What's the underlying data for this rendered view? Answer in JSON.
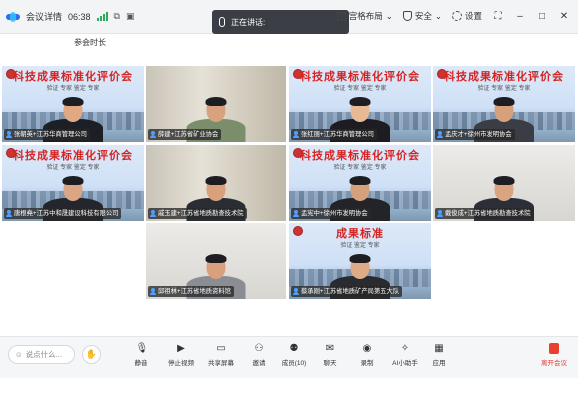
{
  "titlebar": {
    "app_title": "会议详情",
    "time": "06:38",
    "speaking_label": "正在讲话:",
    "layout_label": "宫格布局",
    "security_label": "安全",
    "settings_label": "设置",
    "window_controls": [
      "fullscreen-icon",
      "minimize-icon",
      "maximize-icon",
      "close-icon"
    ]
  },
  "join_time_label": "参会时长",
  "banner": {
    "title": "科技成果标准化评价会",
    "subtitle": "验证 专家 鉴定 专家"
  },
  "banner_short": {
    "title": "成果标准",
    "subtitle": "验证 鉴定 专家"
  },
  "participants": [
    {
      "name": "张朝英+江苏华商管理公司",
      "bg": "banner"
    },
    {
      "name": "薛建+江苏省矿业协会",
      "bg": "room"
    },
    {
      "name": "张红丽+江苏华商管理公司",
      "bg": "banner"
    },
    {
      "name": "孟庆才+徐州市发明协会",
      "bg": "banner",
      "active": true
    },
    {
      "name": "唐根堯+江苏中和晟建设科技有限公司",
      "bg": "banner"
    },
    {
      "name": "戚玉建+江苏省地质勘查技术院",
      "bg": "room"
    },
    {
      "name": "孟宪中+徐州市发明协会",
      "bg": "banner"
    },
    {
      "name": "戴俊成+江苏省地质勘查技术院",
      "bg": "wall"
    },
    {
      "name": "邱祖林+江苏省地质资料馆",
      "bg": "wall"
    },
    {
      "name": "蔡承刚+江苏省地质矿产局第五大队",
      "bg": "banner_short"
    }
  ],
  "toolbar": {
    "input_placeholder": "说点什么...",
    "buttons": [
      {
        "label": "静音",
        "icon": "microphone-icon"
      },
      {
        "label": "停止视频",
        "icon": "video-camera-icon"
      },
      {
        "label": "共享屏幕",
        "icon": "share-screen-icon"
      },
      {
        "label": "邀请",
        "icon": "add-user-icon"
      },
      {
        "label": "成员(10)",
        "icon": "members-icon"
      },
      {
        "label": "聊天",
        "icon": "chat-icon"
      },
      {
        "label": "录制",
        "icon": "record-icon"
      },
      {
        "label": "AI小助手",
        "icon": "ai-assistant-icon"
      },
      {
        "label": "应用",
        "icon": "apps-icon"
      }
    ],
    "leave_label": "离开会议"
  },
  "colors": {
    "accent": "#2fc489",
    "leave_red": "#e23b2e",
    "banner_red": "#d42424"
  }
}
